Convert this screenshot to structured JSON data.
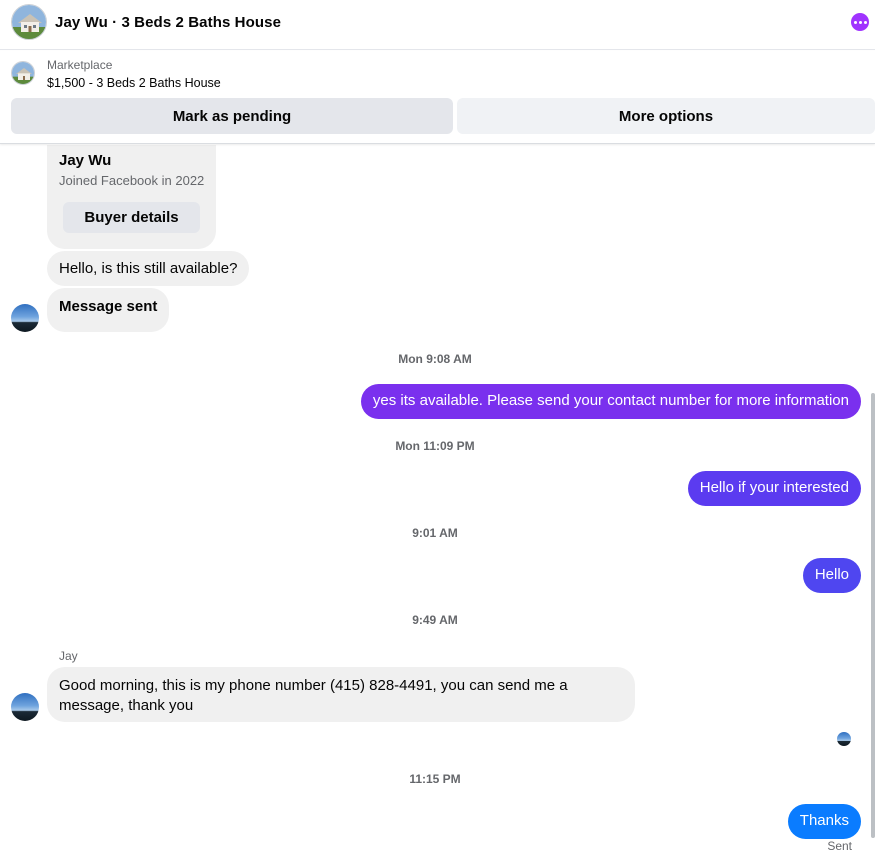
{
  "header": {
    "title": "Jay Wu · 3 Beds 2 Baths House",
    "more_icon": "more-dots-icon",
    "accent": "#a033ff"
  },
  "listing": {
    "label": "Marketplace",
    "title": "$1,500 - 3 Beds 2 Baths House",
    "mark_pending": "Mark as pending",
    "more_options": "More options"
  },
  "buyer_card": {
    "name": "Jay Wu",
    "joined": "Joined Facebook in 2022",
    "details_button": "Buyer details"
  },
  "messages": {
    "m1": "Hello, is this still available?",
    "m2": "Message sent",
    "ts1": "Mon 9:08 AM",
    "m3": "yes its available. Please send your contact number for more information",
    "ts2": "Mon 11:09 PM",
    "m4": "Hello if your interested",
    "ts3": "9:01 AM",
    "m5": "Hello",
    "ts4": "9:49 AM",
    "sender": "Jay",
    "m6": "Good morning, this is my phone number (415) 828-4491, you can send me a message, thank you",
    "ts5": "11:15 PM",
    "m7": "Thanks",
    "status": "Sent"
  },
  "colors": {
    "outgoing_1": "#7a30ee",
    "outgoing_2": "#5b3bf0",
    "outgoing_3": "#4f46f0",
    "outgoing_last": "#0a7cff",
    "incoming": "#f0f0f0"
  }
}
